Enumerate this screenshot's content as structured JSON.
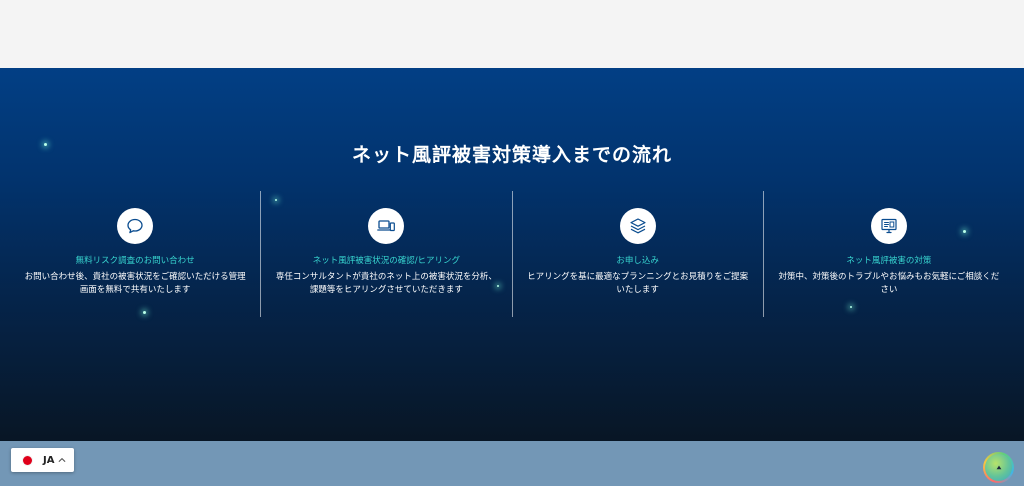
{
  "section": {
    "title": "ネット風評被害対策導入までの流れ"
  },
  "steps": [
    {
      "icon": "speech-bubble-icon",
      "title": "無料リスク調査のお問い合わせ",
      "description": "お問い合わせ後、貴社の被害状況をご確認いただける管理画面を無料で共有いたします"
    },
    {
      "icon": "laptop-phone-icon",
      "title": "ネット風評被害状況の確認/ヒアリング",
      "description": "専任コンサルタントが貴社のネット上の被害状況を分析、課題等をヒアリングさせていただきます"
    },
    {
      "icon": "layers-icon",
      "title": "お申し込み",
      "description": "ヒアリングを基に最適なプランニングとお見積りをご提案いたします"
    },
    {
      "icon": "monitor-plan-icon",
      "title": "ネット風評被害の対策",
      "description": "対策中、対策後のトラブルやお悩みもお気軽にご相談ください"
    }
  ],
  "language_switcher": {
    "label": "JA",
    "flag_icon": "japan-flag-icon",
    "chevron_icon": "chevron-up-icon"
  },
  "scroll_top": {
    "icon": "arrow-up-icon"
  },
  "colors": {
    "step_title": "#38d6d0",
    "hero_top": "#023f85",
    "hero_bottom": "#081625",
    "footer_band": "#7397b6"
  }
}
